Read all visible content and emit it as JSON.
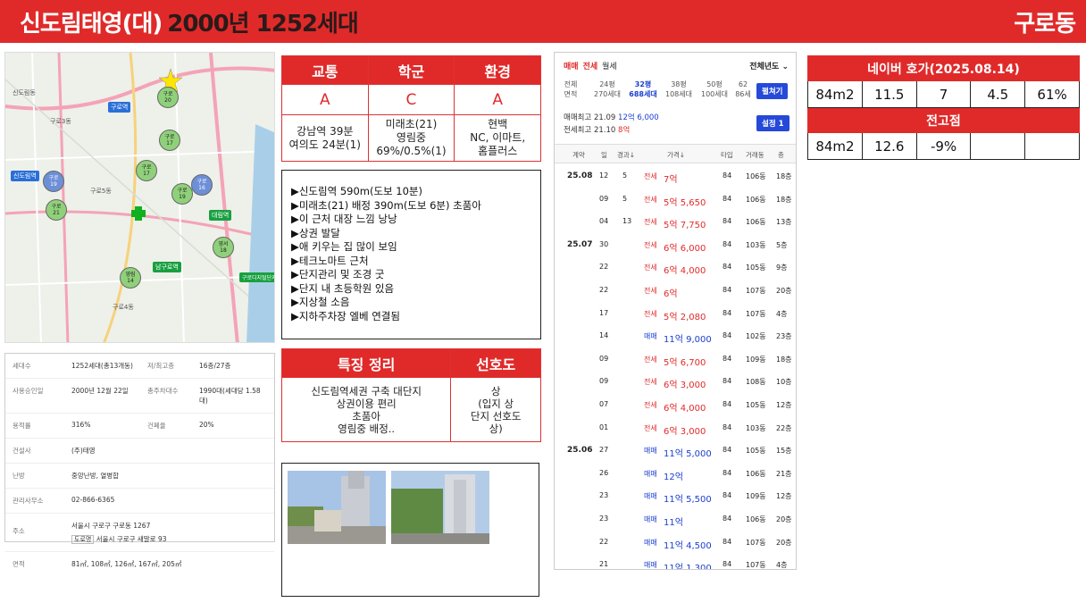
{
  "header": {
    "title_main": "신도림태영(대)",
    "title_sub": "2000년 1252세대",
    "region": "구로동"
  },
  "colors": {
    "accent": "#e02a2a",
    "blue": "#2549d8"
  },
  "map": {
    "labels": [
      "신도림역",
      "구로역",
      "구로3동",
      "대림역",
      "남구로역",
      "구로디지털단지역",
      "구로5동",
      "구로4동",
      "신도림동"
    ],
    "bubbles": [
      {
        "text": "구로\n20",
        "color": "green"
      },
      {
        "text": "구로\n17",
        "color": "green"
      },
      {
        "text": "구로\n16",
        "color": "blue"
      },
      {
        "text": "구로\n17",
        "color": "green"
      },
      {
        "text": "구로\n19",
        "color": "green"
      },
      {
        "text": "영림\n14",
        "color": "green"
      },
      {
        "text": "영서\n18",
        "color": "green"
      },
      {
        "text": "구로\n21",
        "color": "green"
      },
      {
        "text": "구로\n19",
        "color": "blue"
      }
    ]
  },
  "info": {
    "rows": [
      {
        "k": "세대수",
        "v": "1252세대(총13개동)",
        "k2": "저/최고층",
        "v2": "16층/27층"
      },
      {
        "k": "사용승인일",
        "v": "2000년 12월 22일",
        "k2": "총주차대수",
        "v2": "1990대(세대당 1.58대)"
      },
      {
        "k": "용적률",
        "v": "316%",
        "k2": "건폐율",
        "v2": "20%"
      },
      {
        "k": "건설사",
        "v": "(주)태영",
        "k2": "",
        "v2": ""
      },
      {
        "k": "난방",
        "v": "중앙난방, 열병합",
        "k2": "",
        "v2": ""
      },
      {
        "k": "관리사무소",
        "v": "02-866-6365",
        "k2": "",
        "v2": ""
      },
      {
        "k": "주소",
        "v": "서울시 구로구 구로동 1267",
        "v_extra_tag": "도로명",
        "v_extra": "서울시 구로구 새말로 93",
        "k2": "",
        "v2": ""
      },
      {
        "k": "면적",
        "v": "81㎡, 108㎡, 126㎡, 167㎡, 205㎡",
        "k2": "",
        "v2": ""
      }
    ]
  },
  "grades": {
    "headers": [
      "교통",
      "학군",
      "환경"
    ],
    "values": [
      "A",
      "C",
      "A"
    ],
    "details": [
      "강남역 39분\n여의도 24분(1)",
      "미래초(21)\n영림중\n69%/0.5%(1)",
      "현백\nNC, 이마트,\n홈플러스"
    ]
  },
  "features_list": [
    "▶신도림역 590m(도보 10분)",
    "▶미래초(21) 배정 390m(도보 6분) 초품아",
    "▶이 근처 대장 느낌 낭낭",
    "▶상권 발달",
    "▶애 키우는 집 많이 보임",
    "▶테크노마트 근처",
    "▶단지관리 및 조경 굿",
    "▶단지 내 초등학원 있음",
    "▶지상철 소음",
    "▶지하주차장 엘베 연결됨"
  ],
  "summary": {
    "header1": "특징 정리",
    "header2": "선호도",
    "text1": "신도림역세권 구축 대단지\n상권이용 편리\n초품아\n영림중 배정..",
    "text2": "상\n(입지 상\n단지 선호도\n상)"
  },
  "panel": {
    "tabs": [
      "매매",
      "전세",
      "월세"
    ],
    "year_select": "전체년도 ⌄",
    "area_header": [
      "전체",
      "면적"
    ],
    "areas": [
      {
        "size": "24평",
        "units": "270세대",
        "active": false
      },
      {
        "size": "32평",
        "units": "688세대",
        "active": true
      },
      {
        "size": "38평",
        "units": "108세대",
        "active": false
      },
      {
        "size": "50평",
        "units": "100세대",
        "active": false
      },
      {
        "size": "62",
        "units": "86세",
        "active": false
      }
    ],
    "btn_expand": "펼쳐기",
    "btn_settings": "설정 1",
    "max_sale_label": "매매최고",
    "max_sale_date": "21.09",
    "max_sale_price": "12억 6,000",
    "max_jeonse_label": "전세최고",
    "max_jeonse_date": "21.10",
    "max_jeonse_price": "8억",
    "columns": [
      "계약",
      "일",
      "경과↓",
      "가격↓",
      "타입",
      "거래동",
      "층"
    ],
    "rows": [
      {
        "month": "25.08",
        "day": "12",
        "elapsed": "5",
        "type": "전세",
        "price": "7억",
        "area": "84",
        "dong": "106동",
        "floor": "18층"
      },
      {
        "month": "",
        "day": "09",
        "elapsed": "5",
        "type": "전세",
        "price": "5억 5,650",
        "area": "84",
        "dong": "106동",
        "floor": "18층"
      },
      {
        "month": "",
        "day": "04",
        "elapsed": "13",
        "type": "전세",
        "price": "5억 7,750",
        "area": "84",
        "dong": "106동",
        "floor": "13층"
      },
      {
        "month": "25.07",
        "day": "30",
        "elapsed": "",
        "type": "전세",
        "price": "6억 6,000",
        "area": "84",
        "dong": "103동",
        "floor": "5층"
      },
      {
        "month": "",
        "day": "22",
        "elapsed": "",
        "type": "전세",
        "price": "6억 4,000",
        "area": "84",
        "dong": "105동",
        "floor": "9층"
      },
      {
        "month": "",
        "day": "22",
        "elapsed": "",
        "type": "전세",
        "price": "6억",
        "area": "84",
        "dong": "107동",
        "floor": "20층"
      },
      {
        "month": "",
        "day": "17",
        "elapsed": "",
        "type": "전세",
        "price": "5억 2,080",
        "area": "84",
        "dong": "107동",
        "floor": "4층"
      },
      {
        "month": "",
        "day": "14",
        "elapsed": "",
        "type": "매매",
        "price": "11억 9,000",
        "area": "84",
        "dong": "102동",
        "floor": "23층"
      },
      {
        "month": "",
        "day": "09",
        "elapsed": "",
        "type": "전세",
        "price": "5억 6,700",
        "area": "84",
        "dong": "109동",
        "floor": "18층"
      },
      {
        "month": "",
        "day": "09",
        "elapsed": "",
        "type": "전세",
        "price": "6억 3,000",
        "area": "84",
        "dong": "108동",
        "floor": "10층"
      },
      {
        "month": "",
        "day": "07",
        "elapsed": "",
        "type": "전세",
        "price": "6억 4,000",
        "area": "84",
        "dong": "105동",
        "floor": "12층"
      },
      {
        "month": "",
        "day": "01",
        "elapsed": "",
        "type": "전세",
        "price": "6억 3,000",
        "area": "84",
        "dong": "103동",
        "floor": "22층"
      },
      {
        "month": "25.06",
        "day": "27",
        "elapsed": "",
        "type": "매매",
        "price": "11억 5,000",
        "area": "84",
        "dong": "105동",
        "floor": "15층"
      },
      {
        "month": "",
        "day": "26",
        "elapsed": "",
        "type": "매매",
        "price": "12억",
        "area": "84",
        "dong": "106동",
        "floor": "21층"
      },
      {
        "month": "",
        "day": "23",
        "elapsed": "",
        "type": "매매",
        "price": "11억 5,500",
        "area": "84",
        "dong": "109동",
        "floor": "12층"
      },
      {
        "month": "",
        "day": "23",
        "elapsed": "",
        "type": "매매",
        "price": "11억",
        "area": "84",
        "dong": "106동",
        "floor": "20층"
      },
      {
        "month": "",
        "day": "22",
        "elapsed": "",
        "type": "매매",
        "price": "11억 4,500",
        "area": "84",
        "dong": "107동",
        "floor": "20층"
      },
      {
        "month": "",
        "day": "21",
        "elapsed": "",
        "type": "매매",
        "price": "11억 1,300",
        "area": "84",
        "dong": "107동",
        "floor": "4층"
      }
    ]
  },
  "naver": {
    "title": "네이버 호가(2025.08.14)",
    "row": [
      "84m2",
      "11.5",
      "7",
      "4.5",
      "61%"
    ],
    "prev_title": "전고점",
    "prev_row": [
      "84m2",
      "12.6",
      "-9%",
      "",
      ""
    ]
  }
}
